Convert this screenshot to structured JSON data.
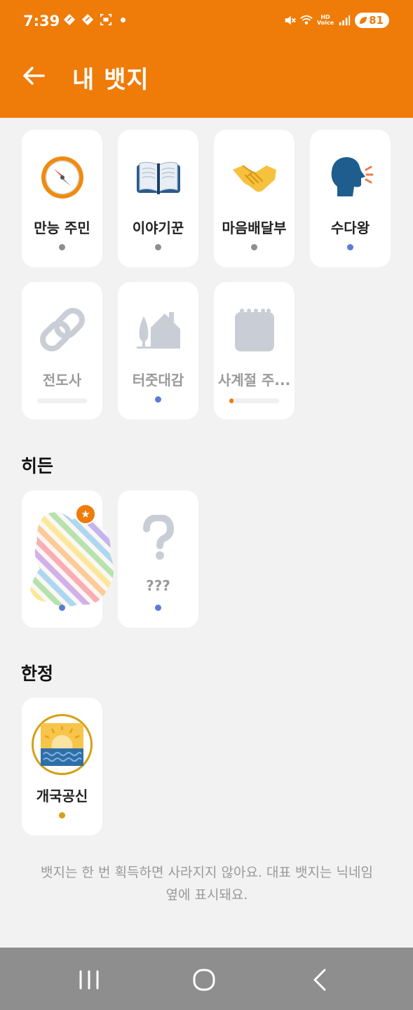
{
  "status_bar": {
    "time": "7:39",
    "battery": "81",
    "hd_label": "HD",
    "voice_label": "Voice"
  },
  "header": {
    "title": "내 뱃지",
    "accent_color": "#ef7b08"
  },
  "badges": [
    {
      "label": "만능 주민",
      "icon": "compass-icon",
      "indicator": "dot",
      "color": "#8e8e8e"
    },
    {
      "label": "이야기꾼",
      "icon": "open-book-icon",
      "indicator": "dot",
      "color": "#8e8e8e"
    },
    {
      "label": "마음배달부",
      "icon": "handshake-icon",
      "indicator": "dot",
      "color": "#8e8e8e"
    },
    {
      "label": "수다왕",
      "icon": "speaking-head-icon",
      "indicator": "dot",
      "color": "#5b7bd5"
    },
    {
      "label": "전도사",
      "icon": "link-icon",
      "indicator": "progress",
      "progress": 0.0
    },
    {
      "label": "터줏대감",
      "icon": "house-icon",
      "indicator": "dot",
      "color": "#5b7bd5"
    },
    {
      "label": "사계절 주...",
      "icon": "calendar-icon",
      "indicator": "progress",
      "progress": 0.05
    }
  ],
  "hidden_section": {
    "title": "히든",
    "badges": [
      {
        "label": "",
        "icon": "rainbow-sticker-icon",
        "indicator": "dot",
        "color": "#5b7bd5",
        "featured": true
      },
      {
        "label": "???",
        "icon": "question-mark-icon",
        "indicator": "dot",
        "color": "#5b7bd5"
      }
    ]
  },
  "limited_section": {
    "title": "한정",
    "badges": [
      {
        "label": "개국공신",
        "icon": "sunrise-icon",
        "indicator": "dot",
        "color": "#d4a017"
      }
    ]
  },
  "footer_line1": "뱃지는 한 번 획득하면 사라지지 않아요. 대표 뱃지는 닉네임",
  "footer_line2": "옆에 표시돼요."
}
